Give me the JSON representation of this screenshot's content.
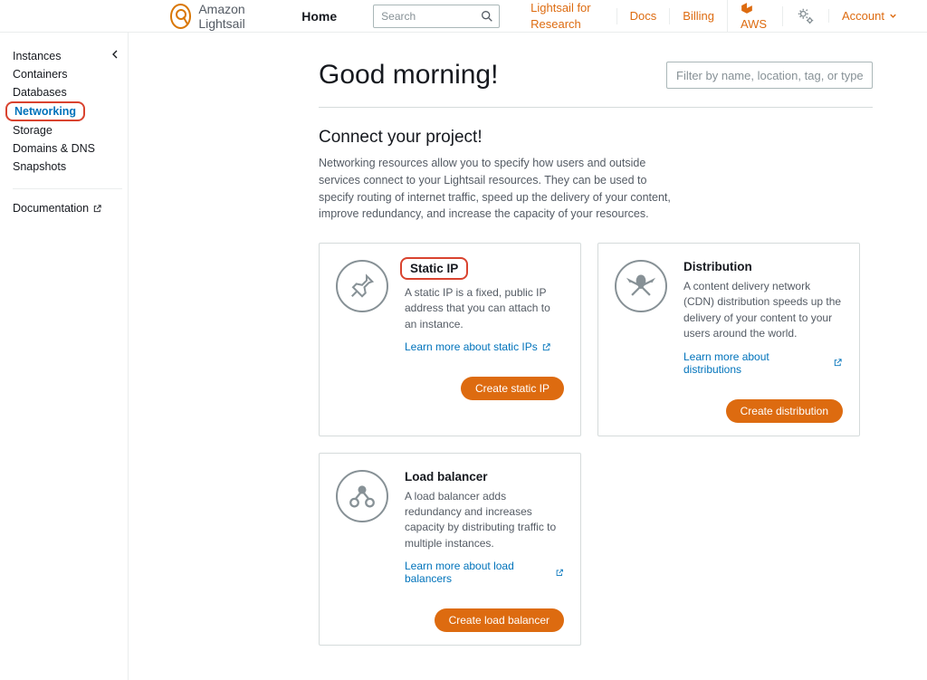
{
  "brand": {
    "name": "Amazon Lightsail"
  },
  "topnav": {
    "home": "Home",
    "search_placeholder": "Search",
    "links": {
      "research": "Lightsail for Research",
      "docs": "Docs",
      "billing": "Billing",
      "aws": "AWS"
    },
    "account": "Account"
  },
  "sidebar": {
    "items": [
      {
        "label": "Instances"
      },
      {
        "label": "Containers"
      },
      {
        "label": "Databases"
      },
      {
        "label": "Networking",
        "active": true,
        "highlighted": true
      },
      {
        "label": "Storage"
      },
      {
        "label": "Domains & DNS"
      },
      {
        "label": "Snapshots"
      }
    ],
    "documentation": "Documentation"
  },
  "main": {
    "greeting": "Good morning!",
    "filter_placeholder": "Filter by name, location, tag, or type",
    "section": {
      "title": "Connect your project!",
      "description": "Networking resources allow you to specify how users and outside services connect to your Lightsail resources. They can be used to specify routing of internet traffic, speed up the delivery of your content, improve redundancy, and increase the capacity of your resources."
    },
    "cards": {
      "static_ip": {
        "title": "Static IP",
        "text": "A static IP is a fixed, public IP address that you can attach to an instance.",
        "learn": "Learn more about static IPs",
        "button": "Create static IP"
      },
      "distribution": {
        "title": "Distribution",
        "text": "A content delivery network (CDN) distribution speeds up the delivery of your content to your users around the world.",
        "learn": "Learn more about distributions",
        "button": "Create distribution"
      },
      "load_balancer": {
        "title": "Load balancer",
        "text": "A load balancer adds redundancy and increases capacity by distributing traffic to multiple instances.",
        "learn": "Learn more about load balancers",
        "button": "Create load balancer"
      }
    }
  }
}
